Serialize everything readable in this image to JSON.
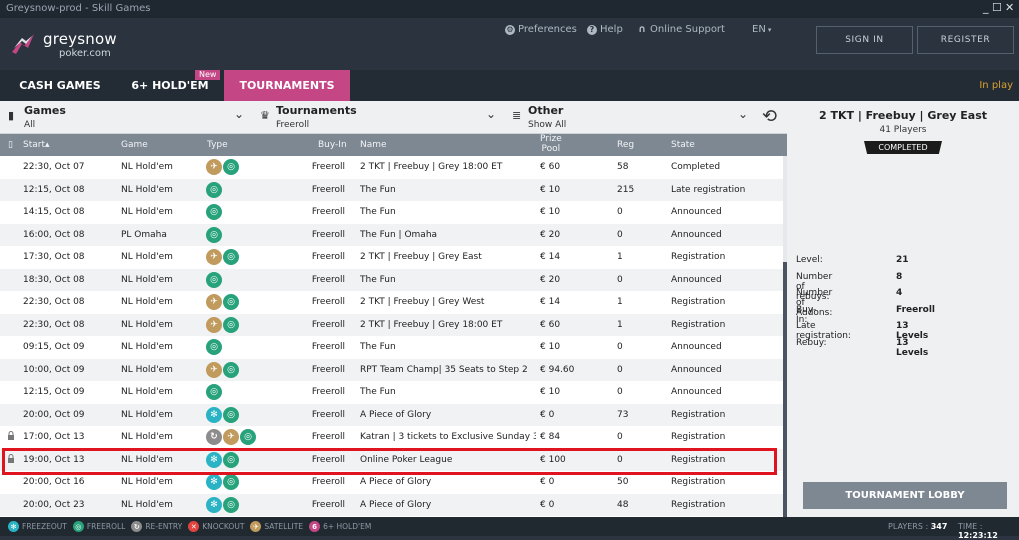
{
  "window": {
    "title": "Greysnow-prod - Skill Games",
    "minimize": "_",
    "maximize": "☐",
    "close": "✕"
  },
  "logo": {
    "brand": "greysnow",
    "sub": "poker.com"
  },
  "topnav": {
    "preferences": "Preferences",
    "help": "Help",
    "support": "Online Support",
    "language": "EN"
  },
  "auth": {
    "signin": "SIGN IN",
    "register": "REGISTER"
  },
  "tabs": {
    "cash": "CASH GAMES",
    "sixplus": "6+ HOLD'EM",
    "sixplus_badge": "New",
    "tournaments": "TOURNAMENTS",
    "inplay": "In play"
  },
  "filters": {
    "games": {
      "title": "Games",
      "value": "All"
    },
    "tournaments": {
      "title": "Tournaments",
      "value": "Freeroll"
    },
    "other": {
      "title": "Other",
      "value": "Show All"
    }
  },
  "columns": {
    "start": "Start",
    "sort_arrow": "▴",
    "game": "Game",
    "type": "Type",
    "buyin": "Buy-In",
    "name": "Name",
    "prize_l1": "Prize",
    "prize_l2": "Pool",
    "reg": "Reg",
    "state": "State"
  },
  "rows": [
    {
      "start": "22:30, Oct 07",
      "game": "NL Hold'em",
      "types": [
        "satellite",
        "freeroll"
      ],
      "buyin": "Freeroll",
      "name": "2 TKT | Freebuy | Grey 18:00 ET",
      "prize": "€ 60",
      "reg": "58",
      "state": "Completed",
      "locked": false
    },
    {
      "start": "12:15, Oct 08",
      "game": "NL Hold'em",
      "types": [
        "freeroll"
      ],
      "buyin": "Freeroll",
      "name": "The Fun",
      "prize": "€ 10",
      "reg": "215",
      "state": "Late registration",
      "locked": false
    },
    {
      "start": "14:15, Oct 08",
      "game": "NL Hold'em",
      "types": [
        "freeroll"
      ],
      "buyin": "Freeroll",
      "name": "The Fun",
      "prize": "€ 10",
      "reg": "0",
      "state": "Announced",
      "locked": false
    },
    {
      "start": "16:00, Oct 08",
      "game": "PL Omaha",
      "types": [
        "freeroll"
      ],
      "buyin": "Freeroll",
      "name": "The Fun | Omaha",
      "prize": "€ 20",
      "reg": "0",
      "state": "Announced",
      "locked": false
    },
    {
      "start": "17:30, Oct 08",
      "game": "NL Hold'em",
      "types": [
        "satellite",
        "freeroll"
      ],
      "buyin": "Freeroll",
      "name": "2 TKT | Freebuy | Grey East",
      "prize": "€ 14",
      "reg": "1",
      "state": "Registration",
      "locked": false
    },
    {
      "start": "18:30, Oct 08",
      "game": "NL Hold'em",
      "types": [
        "freeroll"
      ],
      "buyin": "Freeroll",
      "name": "The Fun",
      "prize": "€ 20",
      "reg": "0",
      "state": "Announced",
      "locked": false
    },
    {
      "start": "22:30, Oct 08",
      "game": "NL Hold'em",
      "types": [
        "satellite",
        "freeroll"
      ],
      "buyin": "Freeroll",
      "name": "2 TKT | Freebuy | Grey West",
      "prize": "€ 14",
      "reg": "1",
      "state": "Registration",
      "locked": false
    },
    {
      "start": "22:30, Oct 08",
      "game": "NL Hold'em",
      "types": [
        "satellite",
        "freeroll"
      ],
      "buyin": "Freeroll",
      "name": "2 TKT | Freebuy | Grey 18:00 ET",
      "prize": "€ 60",
      "reg": "1",
      "state": "Registration",
      "locked": false
    },
    {
      "start": "09:15, Oct 09",
      "game": "NL Hold'em",
      "types": [
        "freeroll"
      ],
      "buyin": "Freeroll",
      "name": "The Fun",
      "prize": "€ 10",
      "reg": "0",
      "state": "Announced",
      "locked": false
    },
    {
      "start": "10:00, Oct 09",
      "game": "NL Hold'em",
      "types": [
        "satellite",
        "freeroll"
      ],
      "buyin": "Freeroll",
      "name": "RPT Team Champ| 35 Seats to Step 2",
      "prize": "€ 94.60",
      "reg": "0",
      "state": "Announced",
      "locked": false
    },
    {
      "start": "12:15, Oct 09",
      "game": "NL Hold'em",
      "types": [
        "freeroll"
      ],
      "buyin": "Freeroll",
      "name": "The Fun",
      "prize": "€ 10",
      "reg": "0",
      "state": "Announced",
      "locked": false
    },
    {
      "start": "20:00, Oct 09",
      "game": "NL Hold'em",
      "types": [
        "freezeout",
        "freeroll"
      ],
      "buyin": "Freeroll",
      "name": "A Piece of Glory",
      "prize": "€ 0",
      "reg": "73",
      "state": "Registration",
      "locked": false
    },
    {
      "start": "17:00, Oct 13",
      "game": "NL Hold'em",
      "types": [
        "reentry",
        "satellite",
        "freeroll"
      ],
      "buyin": "Freeroll",
      "name": "Katran | 3 tickets to Exclusive  Sunday 3...",
      "prize": "€ 84",
      "reg": "0",
      "state": "Registration",
      "locked": true
    },
    {
      "start": "19:00, Oct 13",
      "game": "NL Hold'em",
      "types": [
        "freezeout",
        "freeroll"
      ],
      "buyin": "Freeroll",
      "name": "Online Poker League",
      "prize": "€ 100",
      "reg": "0",
      "state": "Registration",
      "locked": true
    },
    {
      "start": "20:00, Oct 16",
      "game": "NL Hold'em",
      "types": [
        "freezeout",
        "freeroll"
      ],
      "buyin": "Freeroll",
      "name": "A Piece of Glory",
      "prize": "€ 0",
      "reg": "50",
      "state": "Registration",
      "locked": false
    },
    {
      "start": "20:00, Oct 23",
      "game": "NL Hold'em",
      "types": [
        "freezeout",
        "freeroll"
      ],
      "buyin": "Freeroll",
      "name": "A Piece of Glory",
      "prize": "€ 0",
      "reg": "48",
      "state": "Registration",
      "locked": false
    }
  ],
  "panel": {
    "title": "2 TKT | Freebuy | Grey East",
    "players": "41 Players",
    "state": "COMPLETED",
    "info": [
      {
        "label": "Level:",
        "value": "21"
      },
      {
        "label": "Number of rebuys:",
        "value": "8"
      },
      {
        "label": "Number of Addons:",
        "value": "4"
      },
      {
        "label": "Buy-In:",
        "value": "Freeroll"
      },
      {
        "label": "Late registration:",
        "value": "13 Levels"
      },
      {
        "label": "Rebuy:",
        "value": "13 Levels"
      }
    ],
    "lobby_button": "TOURNAMENT LOBBY"
  },
  "legend": [
    {
      "key": "freezeout",
      "label": "FREEZEOUT",
      "color": "#2ab3c4",
      "glyph": "✻"
    },
    {
      "key": "freeroll",
      "label": "FREEROLL",
      "color": "#27a27a",
      "glyph": "◎"
    },
    {
      "key": "reentry",
      "label": "RE-ENTRY",
      "color": "#8c8c8c",
      "glyph": "↻"
    },
    {
      "key": "knockout",
      "label": "KNOCKOUT",
      "color": "#e0443e",
      "glyph": "✕"
    },
    {
      "key": "satellite",
      "label": "SATELLITE",
      "color": "#c19a5d",
      "glyph": "✈"
    },
    {
      "key": "sixplus",
      "label": "6+ HOLD'EM",
      "color": "#c44685",
      "glyph": "6"
    }
  ],
  "footer": {
    "players_label": "PLAYERS :",
    "players_value": "347",
    "time_label": "TIME :",
    "time_value": "12:23:12"
  },
  "type_icons": {
    "satellite": {
      "color": "#c19a5d",
      "glyph": "✈"
    },
    "freeroll": {
      "color": "#27a27a",
      "glyph": "◎"
    },
    "freezeout": {
      "color": "#2ab3c4",
      "glyph": "✻"
    },
    "reentry": {
      "color": "#8c8c8c",
      "glyph": "↻"
    }
  }
}
